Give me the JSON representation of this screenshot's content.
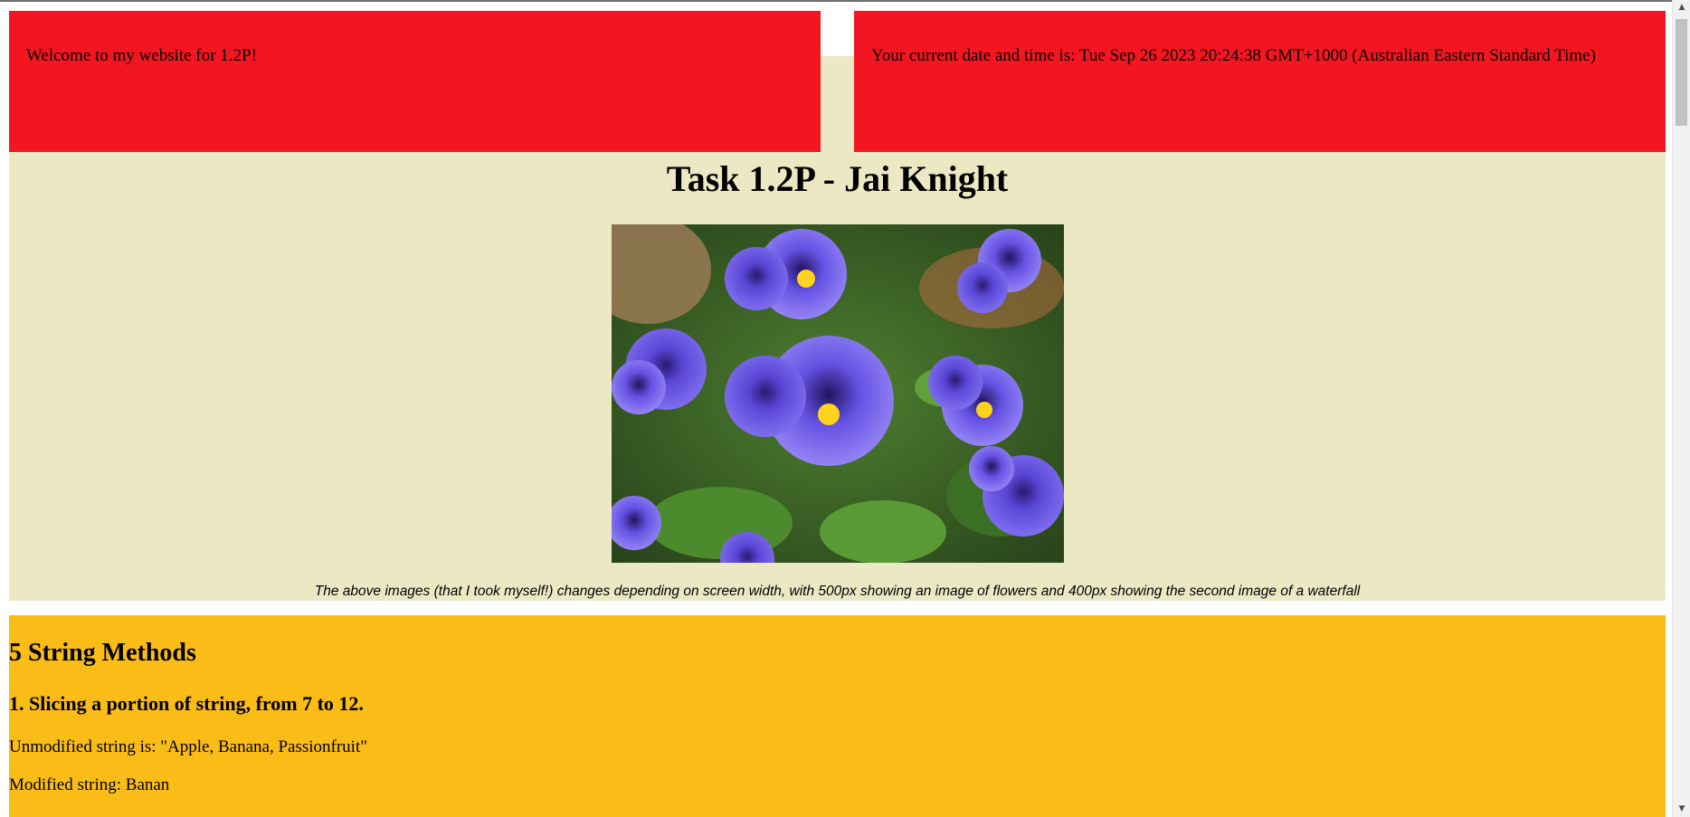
{
  "header": {
    "welcome_text": "Welcome to my website for 1.2P!",
    "datetime_text": "Your current date and time is: Tue Sep 26 2023 20:24:38 GMT+1000 (Australian Eastern Standard Time)"
  },
  "main": {
    "title": "Task 1.2P - Jai Knight",
    "image_icon": "pansy-flowers-photo",
    "caption": "The above images (that I took myself!) changes depending on screen width, with 500px showing an image of flowers and 400px showing the second image of a waterfall"
  },
  "string_methods": {
    "heading": "5 String Methods",
    "method_1": {
      "heading": "1. Slicing a portion of string, from 7 to 12.",
      "unmodified": "Unmodified string is: \"Apple, Banana, Passionfruit\"",
      "modified": "Modified string: Banan"
    }
  },
  "colors": {
    "header_red": "#f31620",
    "band_beige": "#ede8c4",
    "section_yellow": "#fabc16"
  },
  "scrollbar": {
    "up_icon": "scroll-up-arrow-icon",
    "down_icon": "scroll-down-arrow-icon"
  }
}
